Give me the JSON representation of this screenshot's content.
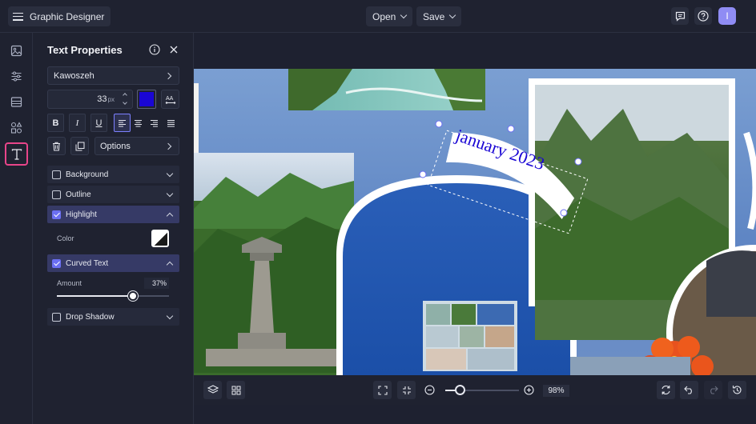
{
  "header": {
    "app_title": "Graphic Designer",
    "open_label": "Open",
    "save_label": "Save",
    "avatar_initial": "I"
  },
  "rail": {
    "items": [
      "image-icon",
      "adjust-icon",
      "layout-icon",
      "elements-icon",
      "text-icon"
    ],
    "active": "text-icon"
  },
  "panel": {
    "title": "Text Properties",
    "font_name": "Kawoszeh",
    "font_size": "33",
    "font_size_unit": "px",
    "text_color": "#1a06d4",
    "options_label": "Options",
    "bold": "B",
    "italic": "I",
    "underline": "U",
    "accordions": {
      "background": "Background",
      "outline": "Outline",
      "highlight": "Highlight",
      "highlight_color_label": "Color",
      "curved": "Curved Text",
      "amount_label": "Amount",
      "amount_value": "37%",
      "amount_fraction": 0.37,
      "drop_shadow": "Drop Shadow"
    }
  },
  "canvas": {
    "curved_text": "january 2023"
  },
  "bottombar": {
    "zoom_value": "98%"
  },
  "colors": {
    "accent": "#6b6ff2",
    "active_rail_outline": "#e8458a",
    "avatar": "#8f8cf4"
  }
}
